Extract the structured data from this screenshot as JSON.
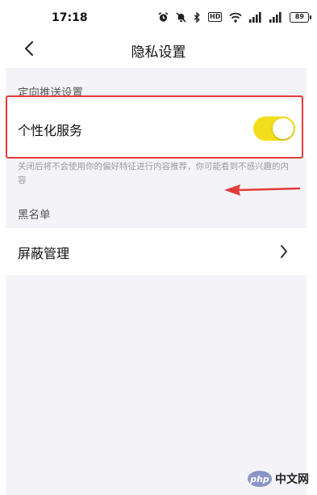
{
  "status_bar": {
    "time": "17:18",
    "icons": [
      "alarm-icon",
      "mute-icon",
      "bluetooth-icon",
      "hd-icon",
      "wifi-icon",
      "signal-icon",
      "signal-icon"
    ],
    "hd_label": "HD",
    "battery": "89"
  },
  "nav": {
    "title": "隐私设置",
    "back_icon": "chevron-left-icon"
  },
  "sections": {
    "targeted_push": {
      "header": "定向推送设置",
      "personalized_service_label": "个性化服务",
      "personalized_service_enabled": true,
      "description": "关闭后将不会使用你的偏好特征进行内容推荐，你可能看到不感兴趣的内容"
    },
    "blacklist": {
      "header": "黑名单",
      "block_management_label": "屏蔽管理",
      "chevron_icon": "chevron-right-icon"
    }
  },
  "colors": {
    "toggle_on": "#f3dd1c",
    "highlight": "#e23b3b",
    "background": "#f4f4f8"
  },
  "watermark": {
    "logo_text": "php",
    "text": "中文网"
  }
}
